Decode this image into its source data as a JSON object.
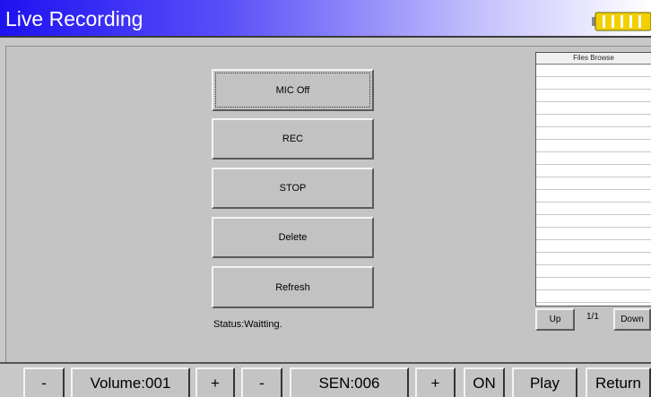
{
  "title": "Live Recording",
  "battery_icon": "battery-full-icon",
  "colors": {
    "title_gradient_start": "#1e12f0",
    "title_gradient_end": "#ffffff",
    "battery_fill": "#f2d000"
  },
  "buttons": {
    "mic": "MIC Off",
    "rec": "REC",
    "stop": "STOP",
    "delete": "Delete",
    "refresh": "Refresh"
  },
  "status": "Status:Waitting.",
  "files_browse": {
    "header": "Files Browse",
    "up": "Up",
    "page": "1/1",
    "down": "Down"
  },
  "bottom_bar": {
    "volume_minus": "-",
    "volume": "Volume:001",
    "volume_plus": "+",
    "sen_minus": "-",
    "sen": "SEN:006",
    "sen_plus": "+",
    "on": "ON",
    "play": "Play",
    "return": "Return"
  }
}
